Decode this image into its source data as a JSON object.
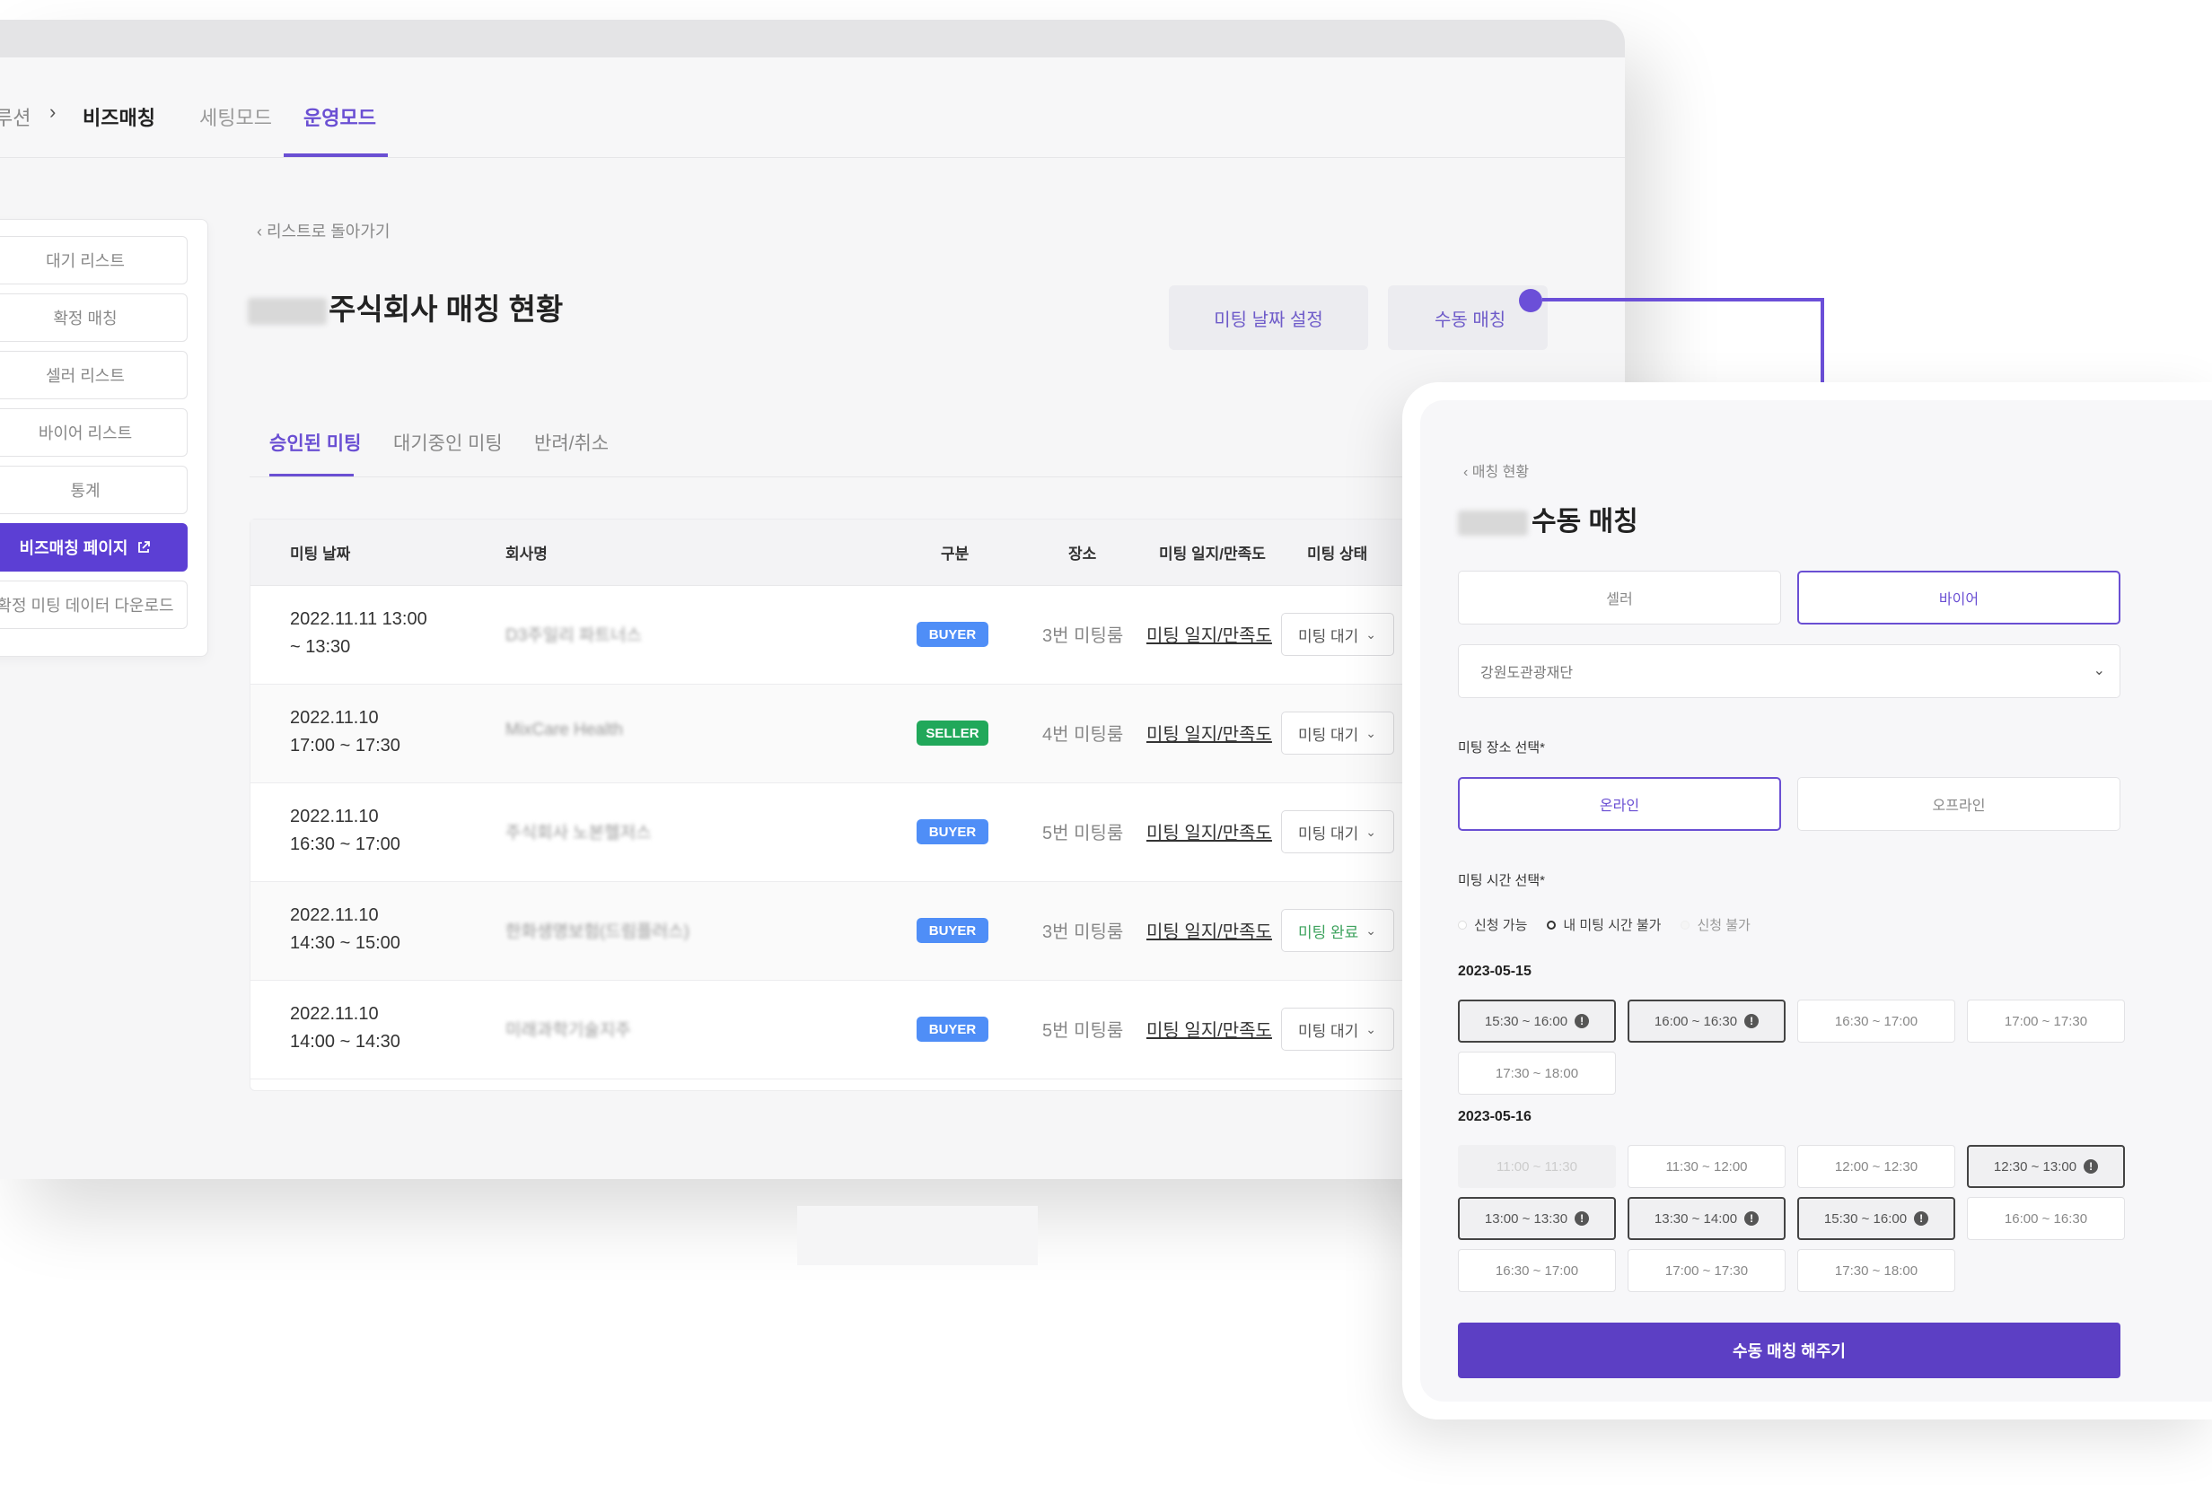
{
  "header": {
    "crumb_prev": "루션",
    "chevron": "›",
    "crumb_current": "비즈매칭",
    "tab_setting": "세팅모드",
    "tab_operate": "운영모드"
  },
  "sidebar": {
    "items": [
      "대기 리스트",
      "확정 매칭",
      "셀러 리스트",
      "바이어 리스트",
      "통계"
    ],
    "biz_page": "비즈매칭 페이지",
    "download": "확정 미팅 데이터 다운로드"
  },
  "main": {
    "back": "‹   리스트로 돌아가기",
    "title": "주식회사 매칭 현황",
    "btn_date": "미팅 날짜 설정",
    "btn_manual": "수동 매칭",
    "tabs": [
      "승인된 미팅",
      "대기중인 미팅",
      "반려/취소"
    ],
    "table": {
      "headers": [
        "미팅 날짜",
        "회사명",
        "구분",
        "장소",
        "미팅 일지/만족도",
        "미팅 상태"
      ],
      "rows": [
        {
          "date": "2022.11.11 13:00\n~ 13:30",
          "company": "D3주일리 파트너스",
          "type": "BUYER",
          "room": "3번 미팅룸",
          "log": "미팅 일지/만족도",
          "status": "미팅 대기"
        },
        {
          "date": "2022.11.10\n17:00 ~ 17:30",
          "company": "MixCare Health",
          "type": "SELLER",
          "room": "4번 미팅룸",
          "log": "미팅 일지/만족도",
          "status": "미팅 대기"
        },
        {
          "date": "2022.11.10\n16:30 ~ 17:00",
          "company": "주식회사 노본헬저스",
          "type": "BUYER",
          "room": "5번 미팅룸",
          "log": "미팅 일지/만족도",
          "status": "미팅 대기"
        },
        {
          "date": "2022.11.10\n14:30 ~ 15:00",
          "company": "한화생명보험(드림플러스)",
          "type": "BUYER",
          "room": "3번 미팅룸",
          "log": "미팅 일지/만족도",
          "status": "미팅 완료"
        },
        {
          "date": "2022.11.10\n14:00 ~ 14:30",
          "company": "미래과학기술지주",
          "type": "BUYER",
          "room": "5번 미팅룸",
          "log": "미팅 일지/만족도",
          "status": "미팅 대기"
        }
      ]
    }
  },
  "panel": {
    "back": "‹   매칭 현황",
    "title": "수동 매칭",
    "seller": "셀러",
    "buyer": "바이어",
    "selected_org": "강원도관광재단",
    "place_label": "미팅 장소 선택*",
    "online": "온라인",
    "offline": "오프라인",
    "time_label": "미팅 시간 선택*",
    "legend": [
      "신청 가능",
      "내 미팅 시간 불가",
      "신청 불가"
    ],
    "date1": "2023-05-15",
    "date1_slots": [
      {
        "t": "15:30 ~ 16:00",
        "s": "mine"
      },
      {
        "t": "16:00 ~ 16:30",
        "s": "mine"
      },
      {
        "t": "16:30 ~ 17:00",
        "s": "free"
      },
      {
        "t": "17:00 ~ 17:30",
        "s": "free"
      },
      {
        "t": "17:30 ~ 18:00",
        "s": "free"
      }
    ],
    "date2": "2023-05-16",
    "date2_slots": [
      {
        "t": "11:00 ~ 11:30",
        "s": "disabled"
      },
      {
        "t": "11:30 ~ 12:00",
        "s": "free"
      },
      {
        "t": "12:00 ~ 12:30",
        "s": "free"
      },
      {
        "t": "12:30 ~ 13:00",
        "s": "mine"
      },
      {
        "t": "13:00 ~ 13:30",
        "s": "mine"
      },
      {
        "t": "13:30 ~ 14:00",
        "s": "mine"
      },
      {
        "t": "15:30 ~ 16:00",
        "s": "mine"
      },
      {
        "t": "16:00 ~ 16:30",
        "s": "free"
      },
      {
        "t": "16:30 ~ 17:00",
        "s": "free"
      },
      {
        "t": "17:00 ~ 17:30",
        "s": "free"
      },
      {
        "t": "17:30 ~ 18:00",
        "s": "free"
      }
    ],
    "submit": "수동 매칭 해주기"
  },
  "colors": {
    "accent": "#6a4fd3",
    "buyer": "#4f8ef7",
    "seller": "#21a85a",
    "done": "#3ea35e"
  }
}
